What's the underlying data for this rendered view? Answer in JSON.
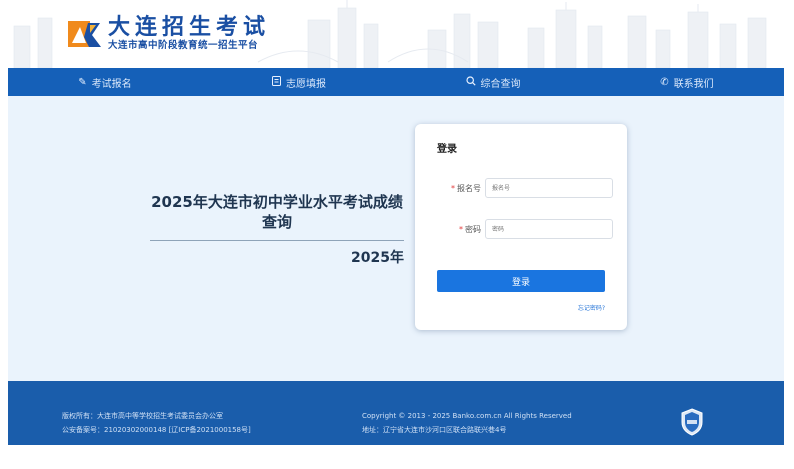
{
  "header": {
    "logo_title": "大连招生考试",
    "logo_subtitle": "大连市高中阶段教育统一招生平台"
  },
  "nav": {
    "items": [
      {
        "label": "考试报名",
        "icon": "pencil-icon"
      },
      {
        "label": "志愿填报",
        "icon": "document-icon"
      },
      {
        "label": "综合查询",
        "icon": "search-icon"
      },
      {
        "label": "联系我们",
        "icon": "phone-icon"
      }
    ]
  },
  "main": {
    "title": "2025年大连市初中学业水平考试成绩查询",
    "year": "2025年"
  },
  "login": {
    "title": "登录",
    "id_label": "报名号",
    "id_placeholder": "报名号",
    "password_label": "密码",
    "password_placeholder": "密码",
    "submit_label": "登录",
    "forgot_label": "忘记密码?"
  },
  "footer": {
    "copyright_owner": "版权所有：大连市高中等学校招生考试委员会办公室",
    "police_record": "公安备案号：21020302000148 [辽ICP备2021000158号]",
    "copyright": "Copyright © 2013 - 2025 Banko.com.cn All Rights Reserved",
    "address": "地址：辽宁省大连市沙河口区联合路联兴巷4号"
  },
  "colors": {
    "brand_blue": "#1560b8",
    "button_blue": "#1a75e0",
    "main_bg": "#eaf3fc"
  }
}
